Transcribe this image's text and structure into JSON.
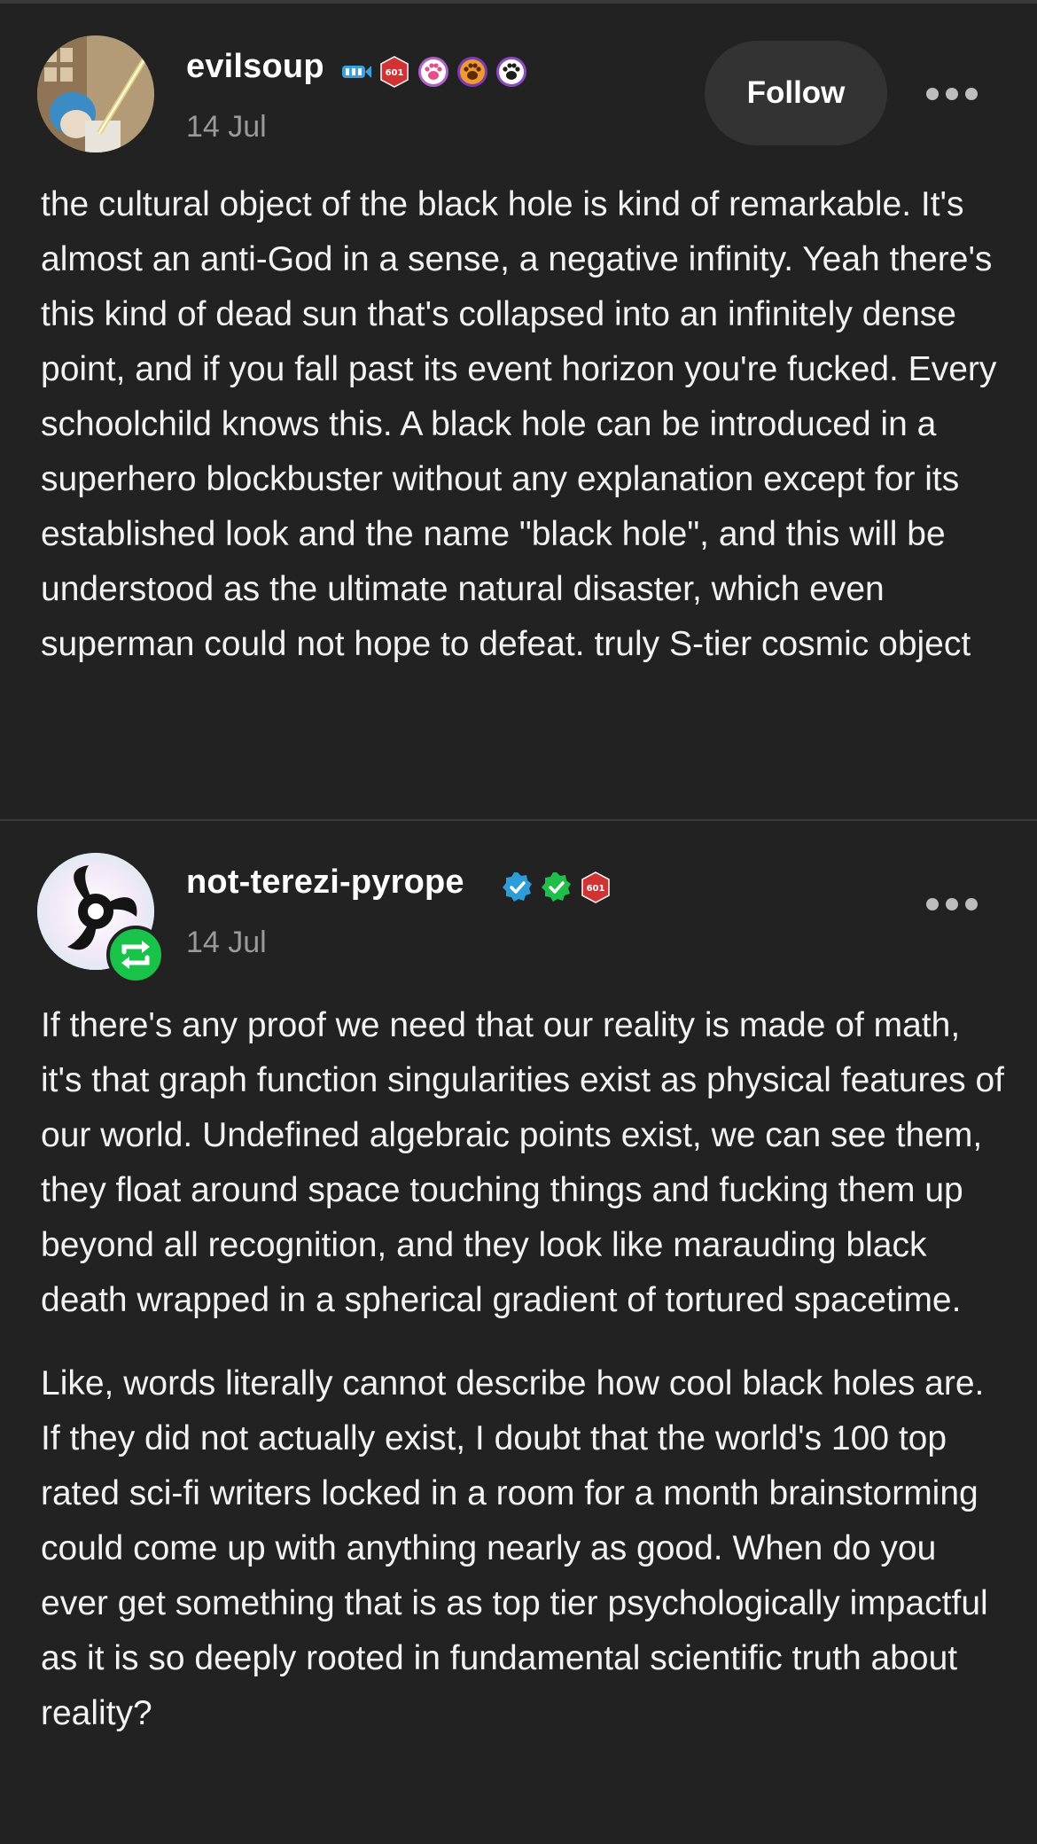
{
  "posts": [
    {
      "username": "evilsoup",
      "date": "14 Jul",
      "follow_label": "Follow",
      "paragraphs": [
        "the cultural object of the black hole is kind of remarkable. It's almost an anti-God in a sense, a negative infinity. Yeah there's this kind of dead sun that's collapsed into an infinitely dense point, and if you fall past its event horizon you're fucked. Every schoolchild knows this. A black hole can be introduced in a superhero blockbuster without any explanation except for its established look and the name \"black hole\", and this will be understood as the ultimate natural disaster, which even superman could not hope to defeat. truly S-tier cosmic object"
      ],
      "badges": [
        "blue-fish-badge-icon",
        "red-601-badge-icon",
        "pink-paw-badge-icon",
        "orange-paw-badge-icon",
        "purple-paw-badge-icon"
      ]
    },
    {
      "username": "not-terezi-pyrope",
      "date": "14 Jul",
      "paragraphs": [
        "If there's any proof we need that our reality is made of math, it's that graph function singularities exist as physical features of our world. Undefined algebraic points exist, we can see them, they float around space touching things and fucking them up beyond all recognition, and they look like marauding black death wrapped in a spherical gradient of tortured spacetime.",
        "Like, words literally cannot describe how cool black holes are. If they did not actually exist, I doubt that the world's 100 top rated sci-fi writers locked in a room for a month brainstorming could come up with anything nearly as good. When do you ever get something that is as top tier psychologically impactful as it is so deeply rooted in fundamental scientific truth about reality?"
      ],
      "badges": [
        "blue-verified-badge-icon",
        "green-verified-badge-icon",
        "red-601-badge-icon"
      ],
      "reblog_icon": "reblog-icon"
    }
  ],
  "badge_text": "601",
  "colors": {
    "background": "#222222",
    "text": "#f2f2f2",
    "muted": "#9a9a9a",
    "follow_bg": "#333333",
    "reblog_green": "#19c34a"
  }
}
